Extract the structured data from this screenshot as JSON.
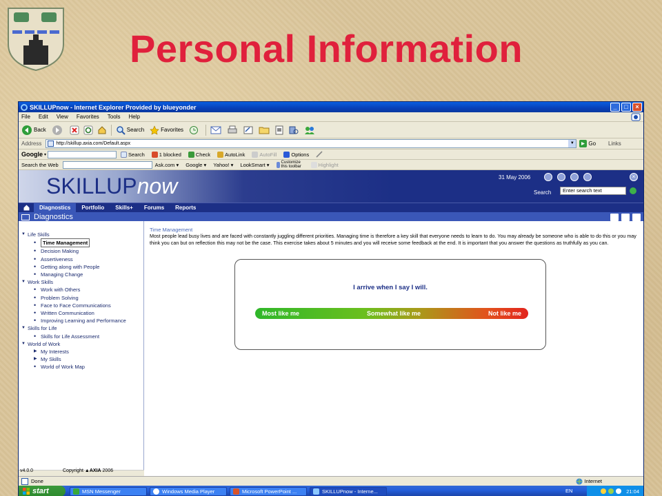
{
  "slide": {
    "title": "Personal Information"
  },
  "window": {
    "title": "SKILLUPnow - Internet Explorer Provided by blueyonder",
    "menu": [
      "File",
      "Edit",
      "View",
      "Favorites",
      "Tools",
      "Help"
    ],
    "toolbar": {
      "back": "Back",
      "search": "Search",
      "favorites": "Favorites"
    },
    "address": {
      "label": "Address",
      "url": "http://skillup.axia.com/Default.aspx",
      "go": "Go",
      "links": "Links"
    },
    "google_bar": {
      "logo": "Google",
      "search": "Search",
      "blocked": "1 blocked",
      "check": "Check",
      "autolink": "AutoLink",
      "autofill": "AutoFill",
      "options": "Options"
    },
    "search_bar": {
      "label": "Search the Web",
      "items": [
        "Ask.com",
        "Google",
        "Yahoo!",
        "LookSmart"
      ],
      "customize": "Customize this toolbar",
      "highlight": "Highlight"
    }
  },
  "site": {
    "logo_main": "SKILLUP",
    "logo_suffix": "now",
    "date": "31 May 2006",
    "search_label": "Search",
    "search_placeholder": "Enter search text",
    "nav": [
      "Diagnostics",
      "Portfolio",
      "Skills+",
      "Forums",
      "Reports"
    ],
    "active_nav": "Diagnostics",
    "page_header": "Diagnostics"
  },
  "sidebar": {
    "sections": [
      {
        "label": "Life Skills",
        "items": [
          {
            "label": "Time Management",
            "selected": true
          },
          {
            "label": "Decision Making"
          },
          {
            "label": "Assertiveness"
          },
          {
            "label": "Getting along with People"
          },
          {
            "label": "Managing Change"
          }
        ]
      },
      {
        "label": "Work Skills",
        "items": [
          {
            "label": "Work with Others"
          },
          {
            "label": "Problem Solving"
          },
          {
            "label": "Face to Face Communications"
          },
          {
            "label": "Written Communication"
          },
          {
            "label": "Improving Learning and Performance"
          }
        ]
      },
      {
        "label": "Skills for Life",
        "items": [
          {
            "label": "Skills for Life Assessment"
          }
        ]
      },
      {
        "label": "World of Work",
        "items": [
          {
            "label": "My Interests",
            "arrow": true
          },
          {
            "label": "My Skills",
            "arrow": true
          },
          {
            "label": "World of Work Map"
          }
        ]
      }
    ]
  },
  "main": {
    "section_title": "Time Management",
    "intro": "Most people lead busy lives and are faced with constantly juggling different priorities. Managing time is therefore a key skill that everyone needs to learn to do. You may already be someone who is able to do this or you may think you can but on reflection this may not be the case. This exercise takes about 5 minutes and you will receive some feedback at the end. It is important that you answer the questions as truthfully as you can.",
    "question": "I arrive when I say I will.",
    "scale": {
      "left": "Most like me",
      "middle": "Somewhat like me",
      "right": "Not like me"
    }
  },
  "footer": {
    "version": "v4.0.0",
    "copyright": "Copyright",
    "brand": "AXIA",
    "year": "2006"
  },
  "status": {
    "text": "Done",
    "zone": "Internet"
  },
  "taskbar": {
    "start": "start",
    "tasks": [
      "MSN Messenger",
      "Windows Media Player",
      "Microsoft PowerPoint ...",
      "SKILLUPnow - Interne..."
    ],
    "lang": "EN",
    "clock": "21:04"
  }
}
